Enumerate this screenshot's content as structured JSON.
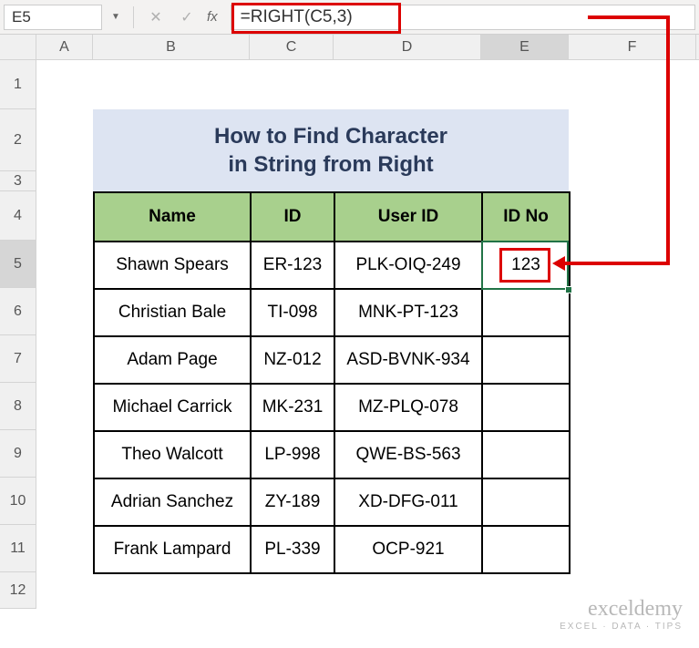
{
  "nameBox": "E5",
  "formula": "=RIGHT(C5,3)",
  "columns": [
    "A",
    "B",
    "C",
    "D",
    "E",
    "F"
  ],
  "rowLabels": [
    "1",
    "2",
    "3",
    "4",
    "5",
    "6",
    "7",
    "8",
    "9",
    "10",
    "11",
    "12"
  ],
  "banner": {
    "line1": "How to Find Character",
    "line2": "in String from Right"
  },
  "headers": {
    "name": "Name",
    "id": "ID",
    "userId": "User ID",
    "idNo": "ID No"
  },
  "rows": [
    {
      "name": "Shawn Spears",
      "id": "ER-123",
      "uid": "PLK-OIQ-249",
      "idno": "123"
    },
    {
      "name": "Christian Bale",
      "id": "TI-098",
      "uid": "MNK-PT-123",
      "idno": ""
    },
    {
      "name": "Adam Page",
      "id": "NZ-012",
      "uid": "ASD-BVNK-934",
      "idno": ""
    },
    {
      "name": "Michael Carrick",
      "id": "MK-231",
      "uid": "MZ-PLQ-078",
      "idno": ""
    },
    {
      "name": "Theo Walcott",
      "id": "LP-998",
      "uid": "QWE-BS-563",
      "idno": ""
    },
    {
      "name": "Adrian Sanchez",
      "id": "ZY-189",
      "uid": "XD-DFG-011",
      "idno": ""
    },
    {
      "name": "Frank Lampard",
      "id": "PL-339",
      "uid": "OCP-921",
      "idno": ""
    }
  ],
  "watermark": {
    "brand": "exceldemy",
    "tag": "EXCEL · DATA · TIPS"
  },
  "icons": {
    "dropdown": "▼",
    "cancel": "✕",
    "enter": "✓"
  },
  "fx": "fx",
  "chart_data": {
    "type": "table",
    "title": "How to Find Character in String from Right",
    "columns": [
      "Name",
      "ID",
      "User ID",
      "ID No"
    ],
    "rows": [
      [
        "Shawn Spears",
        "ER-123",
        "PLK-OIQ-249",
        "123"
      ],
      [
        "Christian Bale",
        "TI-098",
        "MNK-PT-123",
        ""
      ],
      [
        "Adam Page",
        "NZ-012",
        "ASD-BVNK-934",
        ""
      ],
      [
        "Michael Carrick",
        "MK-231",
        "MZ-PLQ-078",
        ""
      ],
      [
        "Theo Walcott",
        "LP-998",
        "QWE-BS-563",
        ""
      ],
      [
        "Adrian Sanchez",
        "ZY-189",
        "XD-DFG-011",
        ""
      ],
      [
        "Frank Lampard",
        "PL-339",
        "OCP-921",
        ""
      ]
    ]
  }
}
